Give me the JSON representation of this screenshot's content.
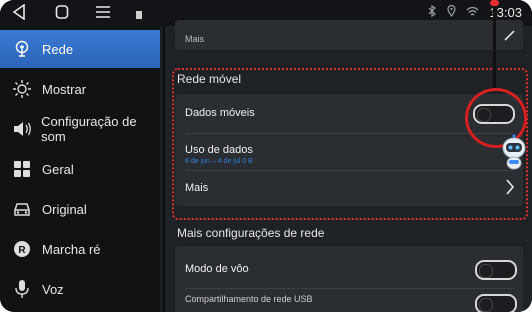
{
  "statusbar": {
    "time": "13:03",
    "icons": [
      "back-icon",
      "home-icon",
      "menu-icon",
      "notification-icon",
      "bluetooth-icon",
      "location-icon",
      "wifi-icon"
    ]
  },
  "sidebar": {
    "items": [
      {
        "label": "Rede",
        "icon": "network-icon",
        "active": true
      },
      {
        "label": "Mostrar",
        "icon": "brightness-icon",
        "active": false
      },
      {
        "label": "Configuração de som",
        "icon": "volume-icon",
        "active": false
      },
      {
        "label": "Geral",
        "icon": "grid-icon",
        "active": false
      },
      {
        "label": "Original",
        "icon": "car-icon",
        "active": false
      },
      {
        "label": "Marcha ré",
        "icon": "reverse-icon",
        "active": false
      },
      {
        "label": "Voz",
        "icon": "microphone-icon",
        "active": false
      }
    ]
  },
  "main": {
    "top_card": {
      "label": "Mais"
    },
    "section_mobile": {
      "title": "Rede móvel",
      "rows": [
        {
          "label": "Dados móveis",
          "toggle": false
        },
        {
          "label": "Uso de dados",
          "subtext": "6 de jun – 4 de jul 0 B"
        },
        {
          "label": "Mais"
        }
      ]
    },
    "section_more": {
      "title": "Mais configurações de rede",
      "rows": [
        {
          "label": "Modo de vôo",
          "toggle": false
        },
        {
          "label": "Compartilhamento de rede USB",
          "toggle": false
        }
      ]
    }
  },
  "annotation_colors": {
    "highlight": "#e62d2d",
    "accent": "#2f7fd8"
  }
}
